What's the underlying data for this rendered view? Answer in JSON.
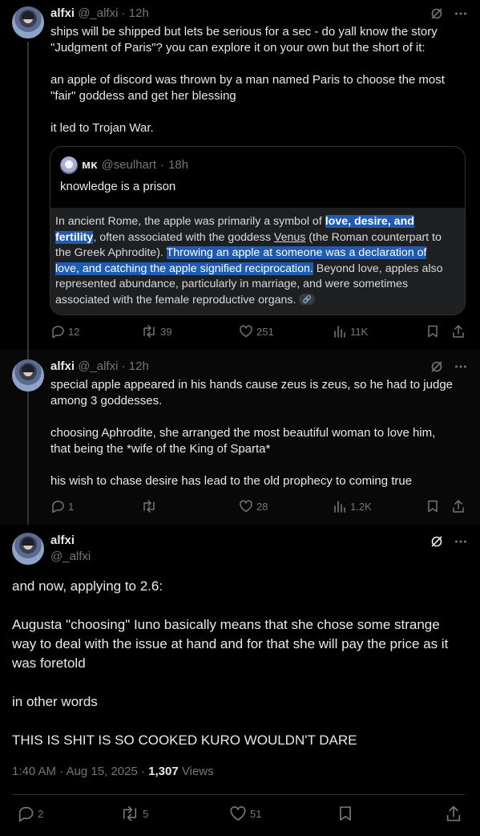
{
  "tweets": [
    {
      "name": "alfxi",
      "handle": "@_alfxi",
      "sep": "·",
      "time": "12h",
      "lines": [
        "ships will be shipped but lets be serious for a sec - do yall know the story",
        "\"Judgment of Paris\"? you can explore it on your own but the short of it:",
        "",
        "an apple of discord was thrown by a man named Paris to choose the most",
        "\"fair\" goddess and get her blessing",
        "",
        "it led to Trojan War."
      ],
      "quote": {
        "name": "мκ",
        "handle": "@seulhart",
        "sep": "·",
        "time": "18h",
        "text": "knowledge is a prison",
        "media": {
          "l1a": "In ancient Rome, the apple was primarily a symbol of ",
          "l1b": "love, desire, and",
          "l2a": "fertility",
          "l2b": ", often associated with the goddess ",
          "l2c": "Venus",
          "l2d": " (the Roman counterpart to",
          "l3a": "the Greek Aphrodite). ",
          "l3b": "Throwing an apple at someone was a declaration of",
          "l4a": "love, and catching the apple signified reciprocation.",
          "l4b": " Beyond love, apples also",
          "l5": "represented abundance, particularly in marriage, and were sometimes",
          "l6": "associated with the female reproductive organs. "
        }
      },
      "stats": {
        "replies": "12",
        "reposts": "39",
        "likes": "251",
        "views": "11K"
      }
    },
    {
      "name": "alfxi",
      "handle": "@_alfxi",
      "sep": "·",
      "time": "12h",
      "lines": [
        "special apple appeared in his hands cause zeus is zeus, so he had to judge",
        "among 3 goddesses.",
        "",
        "choosing Aphrodite, she arranged the most beautiful woman to love him,",
        "that being the *wife of the King of Sparta*",
        "",
        "his wish to chase desire has lead to the old prophecy to coming true"
      ],
      "stats": {
        "replies": "1",
        "reposts": "",
        "likes": "28",
        "views": "1.2K"
      }
    }
  ],
  "focused": {
    "name": "alfxi",
    "handle": "@_alfxi",
    "lines": [
      "and now, applying to 2.6:",
      "",
      "Augusta \"choosing\" Iuno basically means that she chose some strange",
      "way to deal with the issue at hand and for that she will pay the price as it",
      "was foretold",
      "",
      "in other words",
      "",
      "THIS IS SHIT IS SO COOKED KURO WOULDN'T DARE"
    ],
    "time": "1:40 AM",
    "date_sep": "·",
    "date": "Aug 15, 2025",
    "views_sep": "·",
    "views": "1,307",
    "views_label": "Views",
    "stats": {
      "replies": "2",
      "reposts": "5",
      "likes": "51"
    }
  },
  "icons": [
    "grok-icon",
    "more-icon",
    "reply-icon",
    "repost-icon",
    "like-icon",
    "views-icon",
    "bookmark-icon",
    "share-icon",
    "link-icon"
  ],
  "colors": {
    "background": "#000000",
    "text": "#e7e9ea",
    "muted": "#71767b",
    "border": "#2f3336",
    "highlight": "#1f5bb0"
  }
}
